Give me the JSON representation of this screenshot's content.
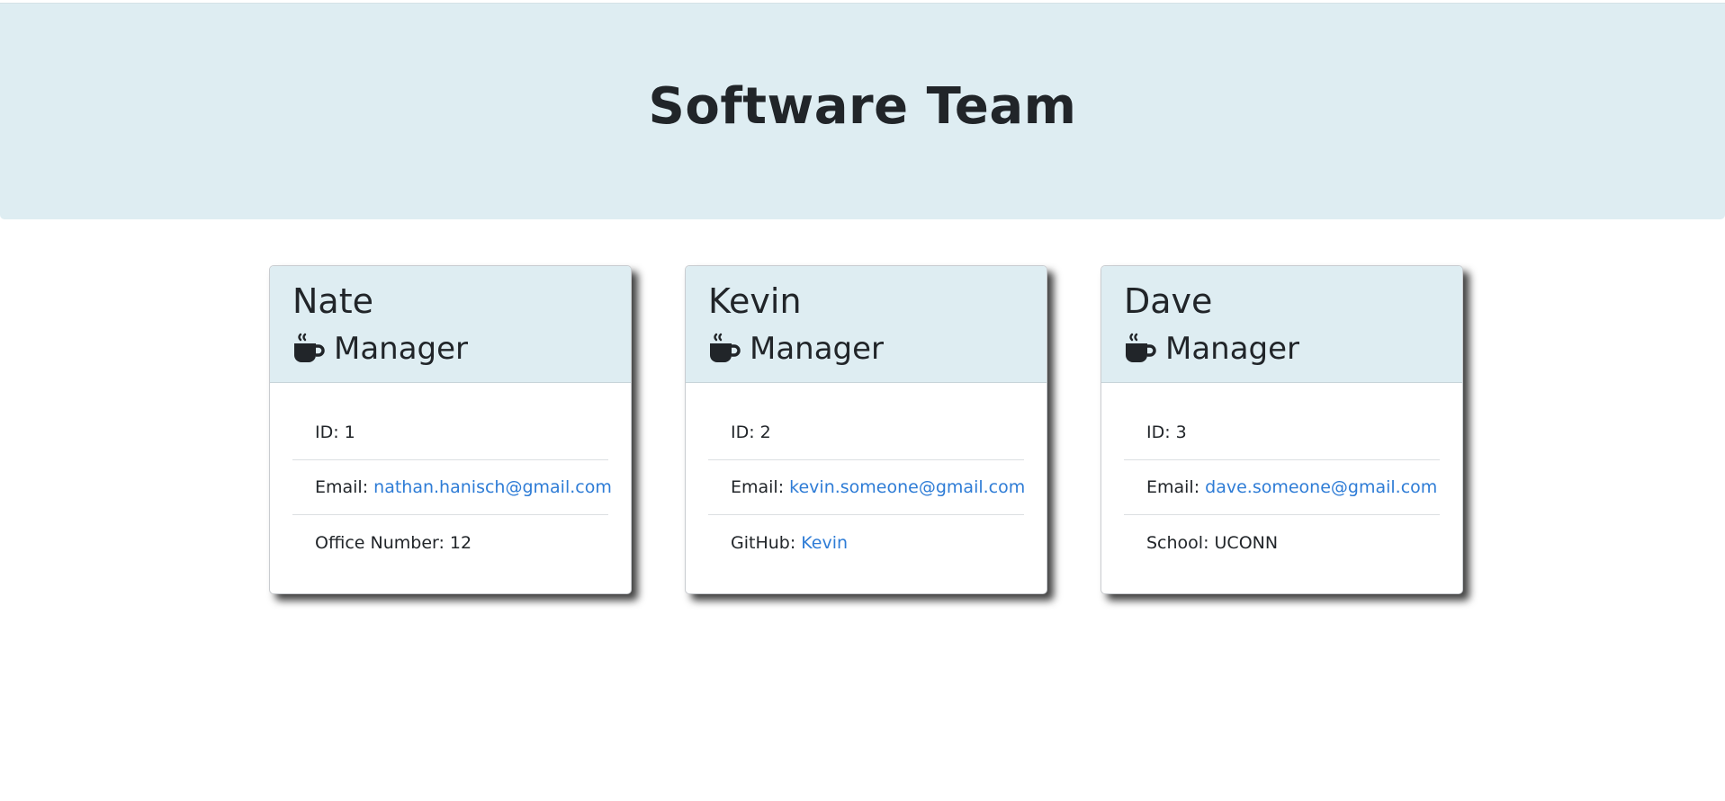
{
  "header": {
    "title": "Software Team"
  },
  "employees": [
    {
      "name": "Nate",
      "role": "Manager",
      "role_icon": "coffee-mug-icon",
      "id_text": "ID: 1",
      "email_label": "Email: ",
      "email": "nathan.hanisch@gmail.com",
      "extra_label": "Office Number: 12",
      "extra_link": ""
    },
    {
      "name": "Kevin",
      "role": "Manager",
      "role_icon": "coffee-mug-icon",
      "id_text": "ID: 2",
      "email_label": "Email: ",
      "email": "kevin.someone@gmail.com",
      "extra_label": "GitHub: ",
      "extra_link": "Kevin"
    },
    {
      "name": "Dave",
      "role": "Manager",
      "role_icon": "coffee-mug-icon",
      "id_text": "ID: 3",
      "email_label": "Email: ",
      "email": "dave.someone@gmail.com",
      "extra_label": "School: UCONN",
      "extra_link": ""
    }
  ],
  "colors": {
    "header_bg": "#deedf2",
    "link": "#2e7cd6",
    "text": "#212529"
  }
}
